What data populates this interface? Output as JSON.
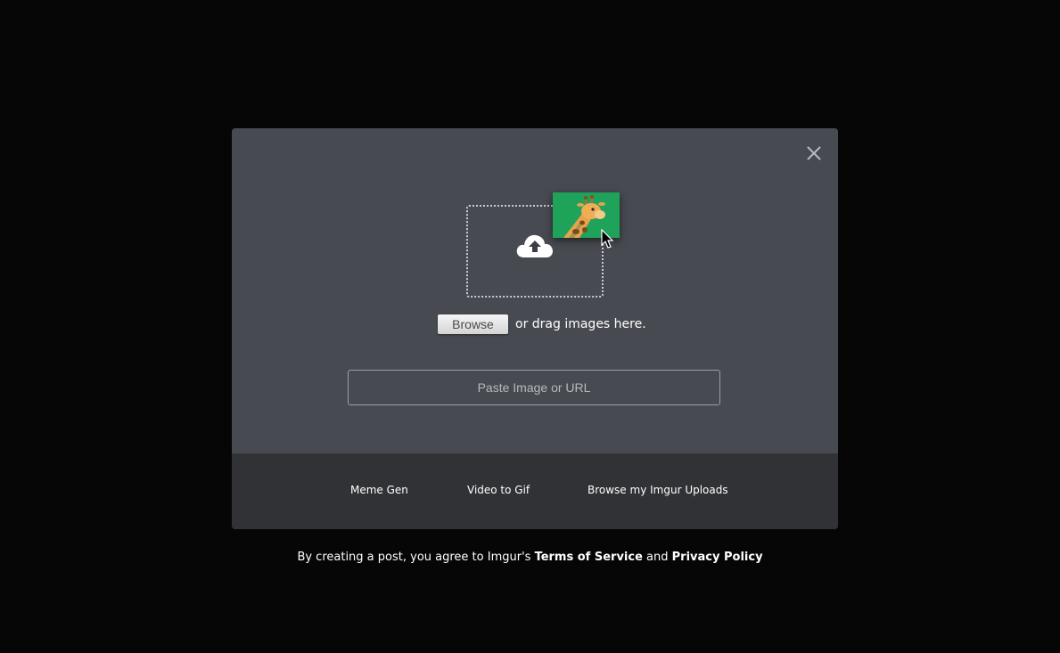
{
  "uploader": {
    "browse_label": "Browse",
    "drag_text": "or drag images here.",
    "url_placeholder": "Paste Image or URL",
    "url_value": ""
  },
  "footer": {
    "links": [
      {
        "label": "Meme Gen"
      },
      {
        "label": "Video to Gif"
      },
      {
        "label": "Browse my Imgur Uploads"
      }
    ]
  },
  "terms": {
    "prefix": "By creating a post, you agree to Imgur's",
    "tos_label": "Terms of Service",
    "conjunction": "and",
    "privacy_label": "Privacy Policy"
  },
  "icons": {
    "close": "close-icon",
    "upload": "cloud-upload-icon",
    "giraffe": "giraffe-image-icon",
    "cursor": "mouse-pointer-icon"
  },
  "colors": {
    "backdrop": "#060606",
    "modal_body": "#474a51",
    "modal_footer": "#303235",
    "giraffe_bg": "#1fa25a"
  }
}
